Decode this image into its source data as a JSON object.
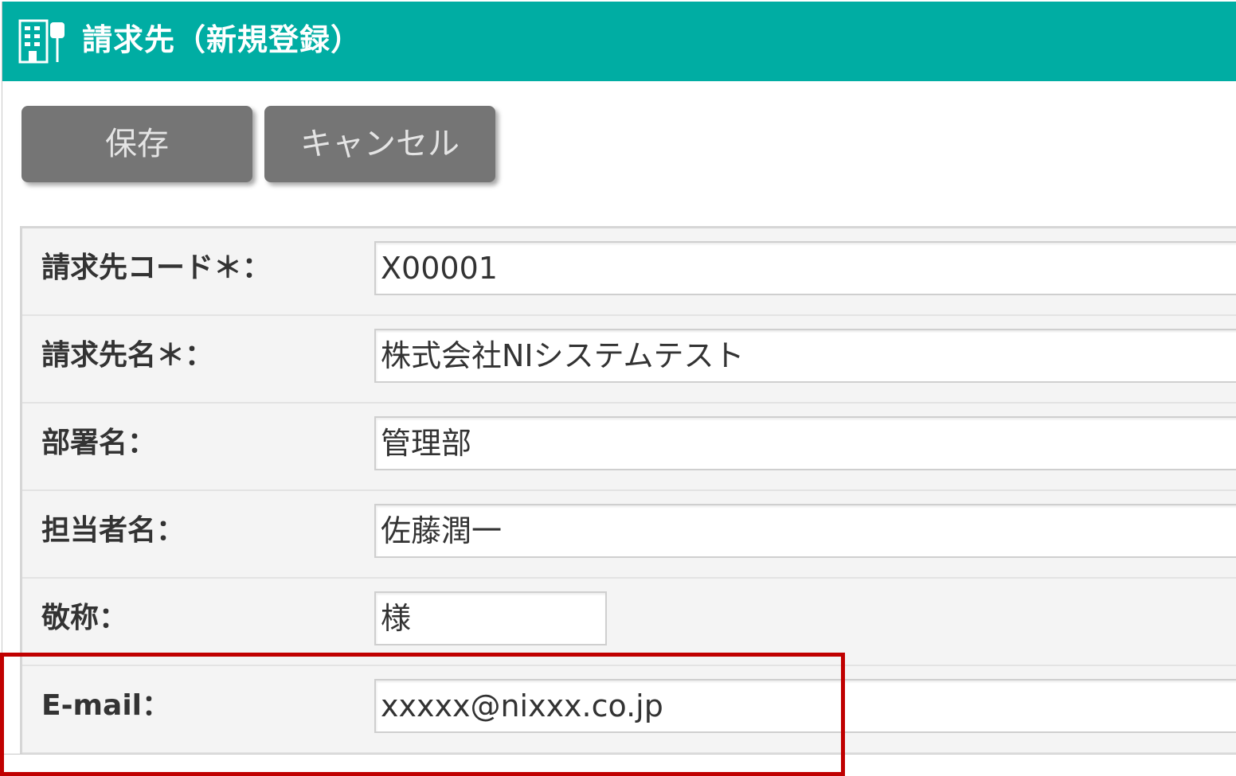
{
  "header": {
    "title": "請求先（新規登録）",
    "icon": "building-icon",
    "color": "#00ada3"
  },
  "toolbar": {
    "save_label": "保存",
    "cancel_label": "キャンセル",
    "button_color": "#757575"
  },
  "form": {
    "fields": [
      {
        "label": "請求先コード＊：",
        "value": "X00001"
      },
      {
        "label": "請求先名＊：",
        "value": "株式会社NIシステムテスト"
      },
      {
        "label": "部署名：",
        "value": "管理部"
      },
      {
        "label": "担当者名：",
        "value": "佐藤潤一"
      },
      {
        "label": "敬称：",
        "value": "様"
      },
      {
        "label": "E-mail：",
        "value": "xxxxx@nixxx.co.jp"
      }
    ]
  },
  "highlight": {
    "target": "email-row",
    "color": "#c00000"
  }
}
